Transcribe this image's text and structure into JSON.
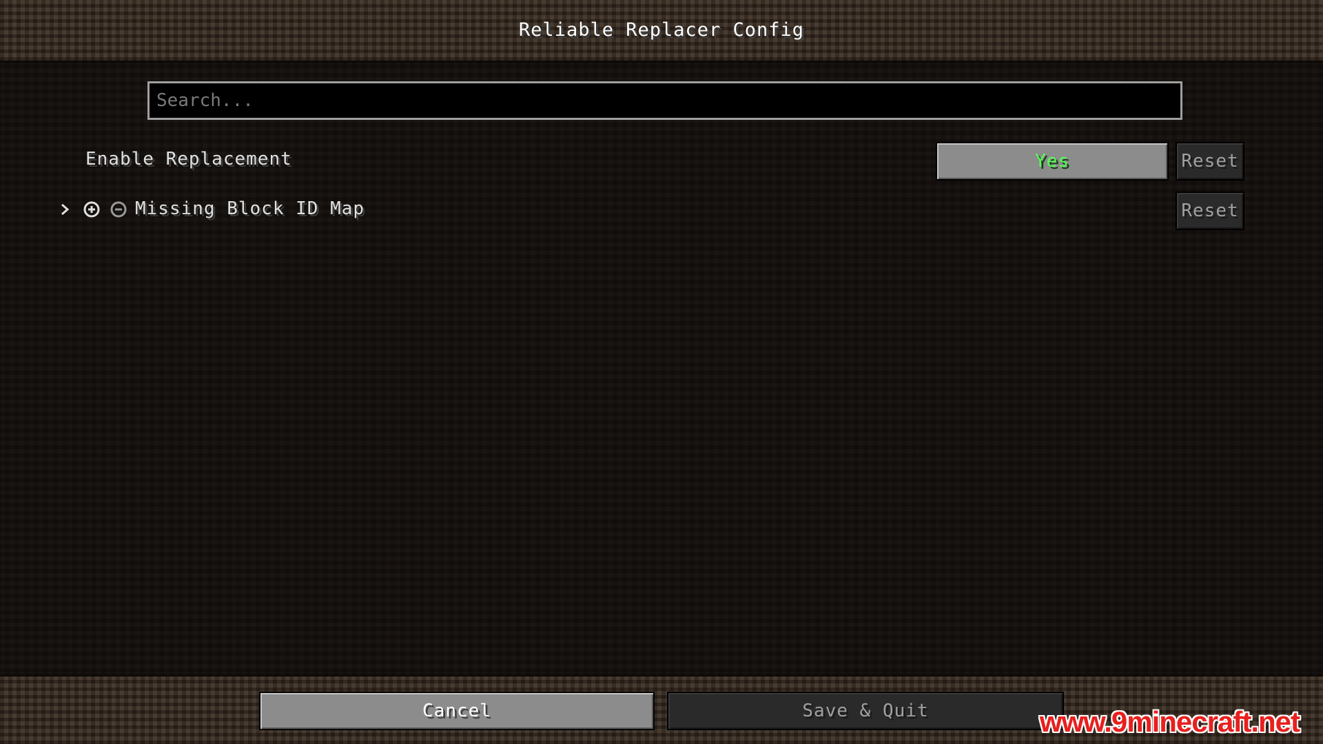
{
  "window": {
    "title": "Reliable Replacer Config"
  },
  "search": {
    "placeholder": "Search...",
    "value": ""
  },
  "entries": [
    {
      "label": "Enable Replacement",
      "value": "Yes",
      "value_color": "#55ff55",
      "reset_label": "Reset"
    },
    {
      "label": "Missing Block ID Map",
      "expand_icon": "chevron-right-icon",
      "add_icon": "plus-circle-icon",
      "remove_icon": "minus-circle-icon",
      "reset_label": "Reset"
    }
  ],
  "footer": {
    "cancel_label": "Cancel",
    "save_label": "Save & Quit"
  },
  "watermark": {
    "text": "www.9minecraft.net",
    "color": "#e8201e"
  }
}
